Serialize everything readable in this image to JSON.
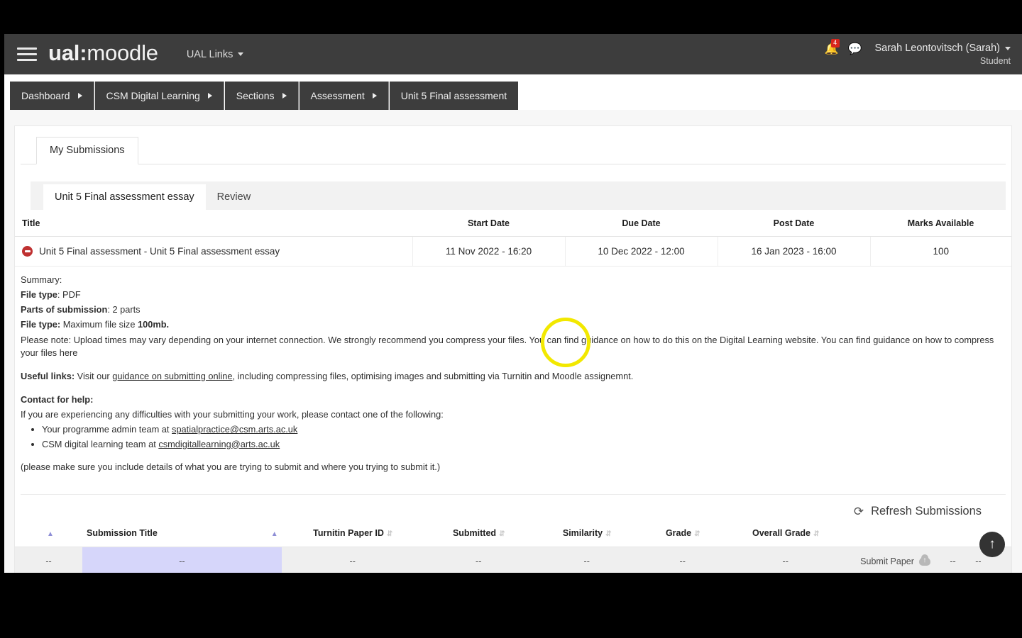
{
  "navbar": {
    "menu_icon": "hamburger-icon",
    "brand_bold": "ual:",
    "brand_light": "moodle",
    "ual_links_label": "UAL Links",
    "notification_icon": "bell-icon",
    "notification_count": "4",
    "messages_icon": "chat-icon",
    "user_name": "Sarah Leontovitsch (Sarah)",
    "user_role": "Student"
  },
  "breadcrumbs": [
    {
      "label": "Dashboard",
      "has_chevron": true
    },
    {
      "label": "CSM Digital Learning",
      "has_chevron": true
    },
    {
      "label": "Sections",
      "has_chevron": true
    },
    {
      "label": "Assessment",
      "has_chevron": true
    },
    {
      "label": "Unit 5 Final assessment",
      "has_chevron": false
    }
  ],
  "outer_tabs": [
    {
      "label": "My Submissions",
      "active": true
    }
  ],
  "inner_tabs": [
    {
      "label": "Unit 5 Final assessment essay",
      "active": true
    },
    {
      "label": "Review",
      "active": false
    }
  ],
  "assignment_table": {
    "headers": [
      "Title",
      "Start Date",
      "Due Date",
      "Post Date",
      "Marks Available"
    ],
    "row": {
      "status_icon": "no-entry-icon",
      "title": "Unit 5 Final assessment - Unit 5 Final assessment essay",
      "start_date": "11 Nov 2022 - 16:20",
      "due_date": "10 Dec 2022 - 12:00",
      "post_date": "16 Jan 2023 - 16:00",
      "marks_available": "100"
    }
  },
  "summary": {
    "heading": "Summary:",
    "file_type_label": "File type",
    "file_type_value": "PDF",
    "parts_label": "Parts of submission",
    "parts_value": "2 parts",
    "size_label": "File type:",
    "size_value_pre": "Maximum file size ",
    "size_value_bold": "100mb.",
    "please_note": "Please note: Upload times may vary depending on your internet connection. We strongly recommend you compress your files. You can find guidance on how to do this on the Digital Learning website. You can find guidance on how to compress your files here",
    "useful_links_label": "Useful links:",
    "useful_links_pre": " Visit our ",
    "useful_links_link": "guidance on submitting online",
    "useful_links_post": ", including compressing files, optimising images and submitting via Turnitin and Moodle assignemnt.",
    "contact_label": "Contact for help:",
    "contact_intro": "If you are experiencing any difficulties with your submitting your work, please contact one of the following:",
    "contact_items": [
      {
        "pre": "Your programme admin team at ",
        "email": "spatialpractice@csm.arts.ac.uk"
      },
      {
        "pre": "CSM digital learning team at ",
        "email": "csmdigitallearning@arts.ac.uk"
      }
    ],
    "closing_note": "(please make sure you include details of what you are trying to submit and where you trying to submit it.)"
  },
  "refresh": {
    "icon": "refresh-icon",
    "label": "Refresh Submissions"
  },
  "submissions_table": {
    "headers": [
      {
        "label": "",
        "sort": "up"
      },
      {
        "label": "Submission Title",
        "sort": "up"
      },
      {
        "label": "Turnitin Paper ID",
        "sort": "both"
      },
      {
        "label": "Submitted",
        "sort": "both"
      },
      {
        "label": "Similarity",
        "sort": "both"
      },
      {
        "label": "Grade",
        "sort": "both"
      },
      {
        "label": "Overall Grade",
        "sort": "both"
      }
    ],
    "row": {
      "index": "--",
      "submission_title": "--",
      "turnitin_paper_id": "--",
      "submitted": "--",
      "similarity": "--",
      "grade": "--",
      "overall_grade": "--",
      "action_label": "Submit Paper",
      "action_icon": "cloud-upload-icon",
      "extra_1": "--",
      "extra_2": "--"
    }
  },
  "scroll_top": {
    "icon": "arrow-up-icon"
  },
  "colors": {
    "navbar_bg": "#3d3d3d",
    "badge_red": "#d9261c",
    "status_red": "#bf3131",
    "highlight_ring": "#f2e800",
    "selected_cell": "#d6d6fa"
  }
}
